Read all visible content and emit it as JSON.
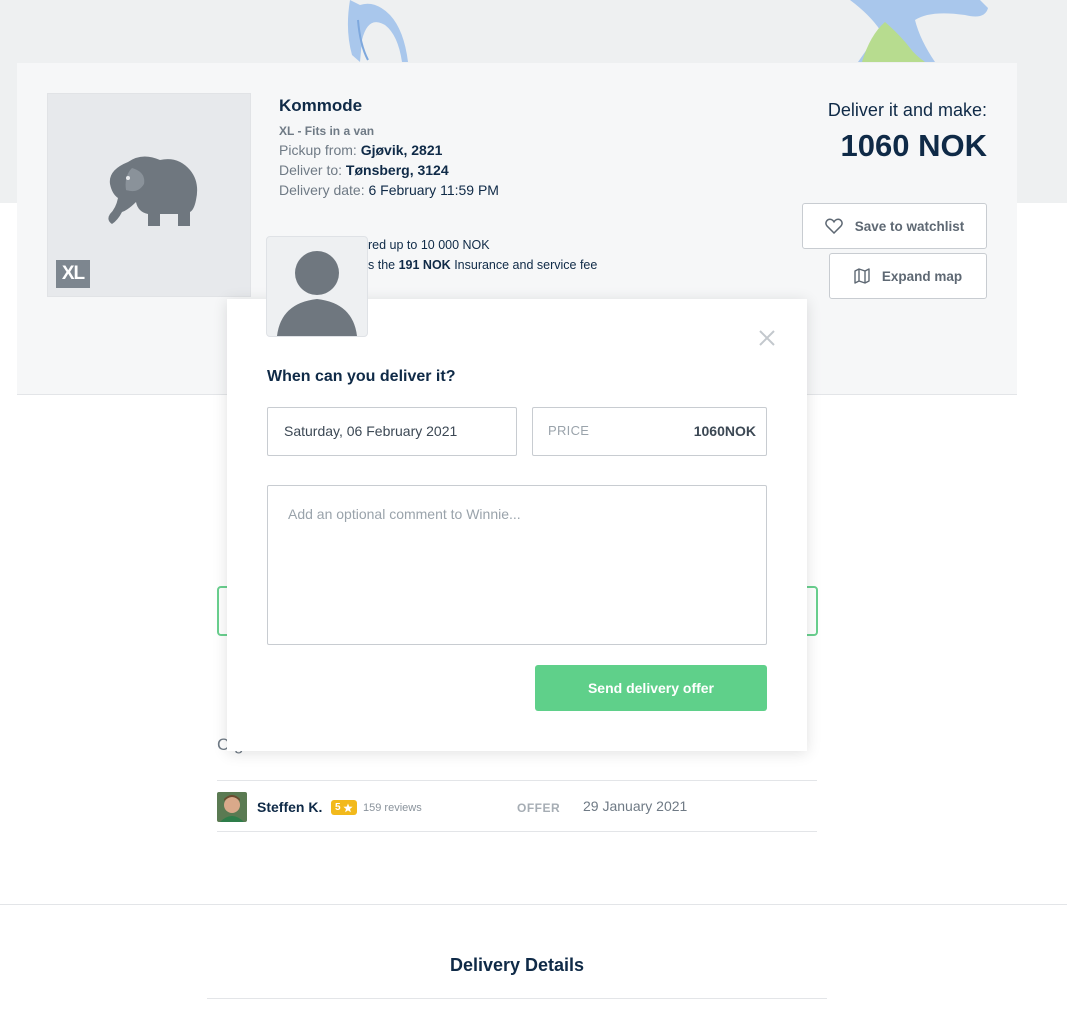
{
  "item": {
    "title": "Kommode",
    "size_badge": "XL",
    "size_label": "XL - Fits in a van",
    "pickup_label": "Pickup from:",
    "pickup_value": "Gjøvik, 2821",
    "deliver_label": "Deliver to:",
    "deliver_value": "Tønsberg, 3124",
    "date_label": "Delivery date:",
    "date_value": "6 February 11:59 PM",
    "insured_fragment": "red up to 10 000 NOK",
    "fee_prefix_fragment": "s the",
    "fee_amount": "191 NOK",
    "fee_suffix": "Insurance and service fee"
  },
  "earn": {
    "label": "Deliver it and make:",
    "value": "1060 NOK"
  },
  "actions": {
    "watchlist_label": "Save to watchlist",
    "map_label": "Expand map"
  },
  "offers": {
    "heading_fragment": "C        g",
    "rows": [
      {
        "name": "Steffen K.",
        "rating": "5",
        "reviews": "159 reviews",
        "type": "OFFER",
        "date": "29 January 2021"
      }
    ]
  },
  "details": {
    "heading": "Delivery Details"
  },
  "modal": {
    "question": "When can you deliver it?",
    "date_value": "Saturday, 06 February 2021",
    "price_label": "PRICE",
    "price_value": "1060NOK",
    "comment_placeholder": "Add an optional comment to Winnie...",
    "send_label": "Send delivery offer"
  },
  "colors": {
    "navy": "#0f2a47",
    "green": "#5fd08a",
    "rating_gold": "#f2b91b",
    "muted": "#6f7a85"
  },
  "icons": {
    "item_image": "elephant-icon",
    "watchlist": "heart-outline-icon",
    "map": "map-icon",
    "close": "close-icon",
    "rating": "star-icon"
  }
}
